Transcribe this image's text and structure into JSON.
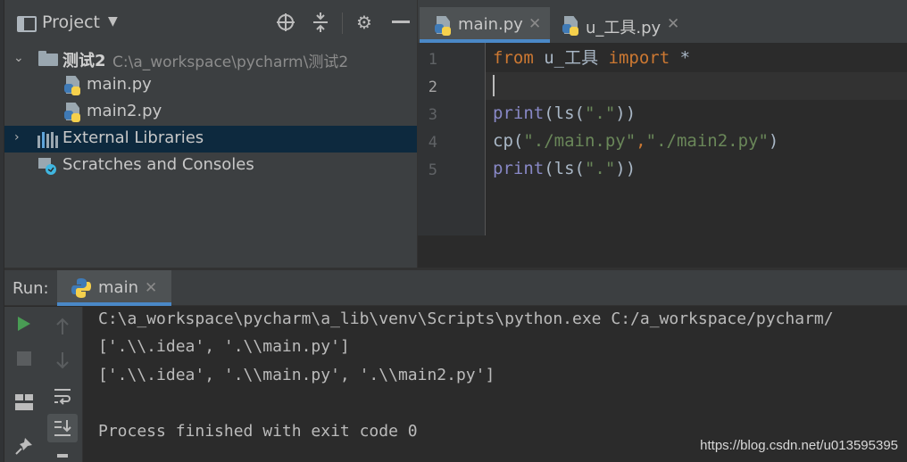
{
  "project_panel": {
    "title": "Project",
    "tree": [
      {
        "label": "测试2",
        "path": "C:\\a_workspace\\pycharm\\测试2"
      },
      {
        "label": "main.py"
      },
      {
        "label": "main2.py"
      },
      {
        "label": "External Libraries"
      },
      {
        "label": "Scratches and Consoles"
      }
    ]
  },
  "editor": {
    "tabs": [
      {
        "label": "main.py",
        "active": true
      },
      {
        "label": "u_工具.py",
        "active": false
      }
    ],
    "line_numbers": [
      "1",
      "2",
      "3",
      "4",
      "5"
    ],
    "lines": [
      {
        "tokens": [
          {
            "t": "from",
            "c": "kw"
          },
          {
            "t": " u_工具 ",
            "c": "id"
          },
          {
            "t": "import",
            "c": "kw"
          },
          {
            "t": " *",
            "c": "id"
          }
        ]
      },
      {
        "tokens": []
      },
      {
        "tokens": [
          {
            "t": "print",
            "c": "fn"
          },
          {
            "t": "(ls(",
            "c": "id"
          },
          {
            "t": "\".\"",
            "c": "str"
          },
          {
            "t": "))",
            "c": "id"
          }
        ]
      },
      {
        "tokens": [
          {
            "t": "cp(",
            "c": "id"
          },
          {
            "t": "\"./main.py\"",
            "c": "str"
          },
          {
            "t": ",",
            "c": "kw"
          },
          {
            "t": "\"./main2.py\"",
            "c": "str"
          },
          {
            "t": ")",
            "c": "id"
          }
        ]
      },
      {
        "tokens": [
          {
            "t": "print",
            "c": "fn"
          },
          {
            "t": "(ls(",
            "c": "id"
          },
          {
            "t": "\".\"",
            "c": "str"
          },
          {
            "t": "))",
            "c": "id"
          }
        ]
      }
    ],
    "current_line": 2
  },
  "run_panel": {
    "label": "Run:",
    "tab_label": "main",
    "console": [
      "C:\\a_workspace\\pycharm\\a_lib\\venv\\Scripts\\python.exe C:/a_workspace/pycharm/",
      "['.\\\\.idea', '.\\\\main.py']",
      "['.\\\\.idea', '.\\\\main.py', '.\\\\main2.py']",
      "",
      "Process finished with exit code 0"
    ]
  },
  "watermark": "https://blog.csdn.net/u013595395",
  "colors": {
    "accent": "#4a88c7",
    "run_green": "#499c54",
    "keyword": "#cc7832",
    "string": "#6a8759",
    "builtin": "#8888c6"
  }
}
